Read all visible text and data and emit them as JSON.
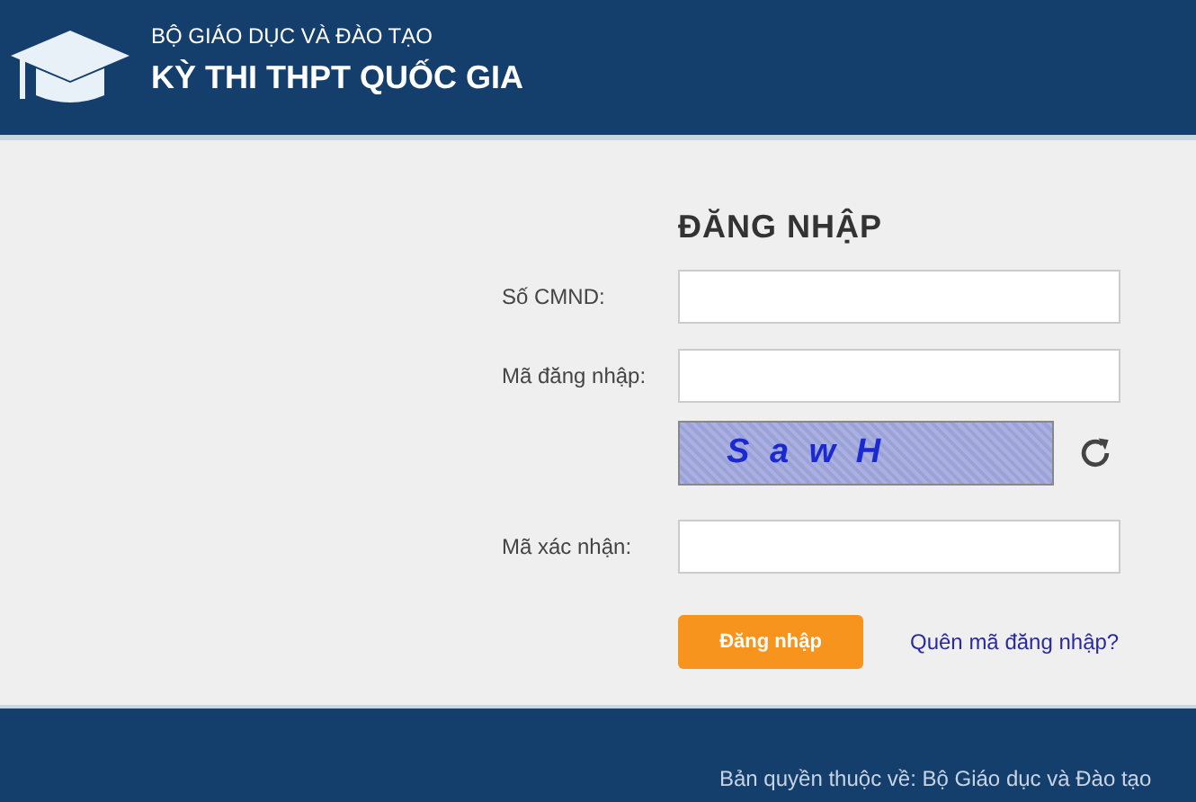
{
  "header": {
    "ministry": "BỘ GIÁO DỤC VÀ ĐÀO TẠO",
    "title": "KỲ THI THPT QUỐC GIA"
  },
  "login": {
    "title": "ĐĂNG NHẬP",
    "fields": [
      {
        "kind": "input",
        "label": "Số CMND:"
      },
      {
        "kind": "input",
        "label": "Mã đăng nhập:"
      },
      {
        "kind": "captcha",
        "captcha": "S a w H"
      },
      {
        "kind": "input",
        "label": "Mã xác nhận:"
      }
    ],
    "submit": "Đăng nhập",
    "forgot_link": "Quên mã đăng nhập?"
  },
  "footer": {
    "copyright": "Bản quyền thuộc về: Bộ Giáo dục và Đào tạo"
  }
}
